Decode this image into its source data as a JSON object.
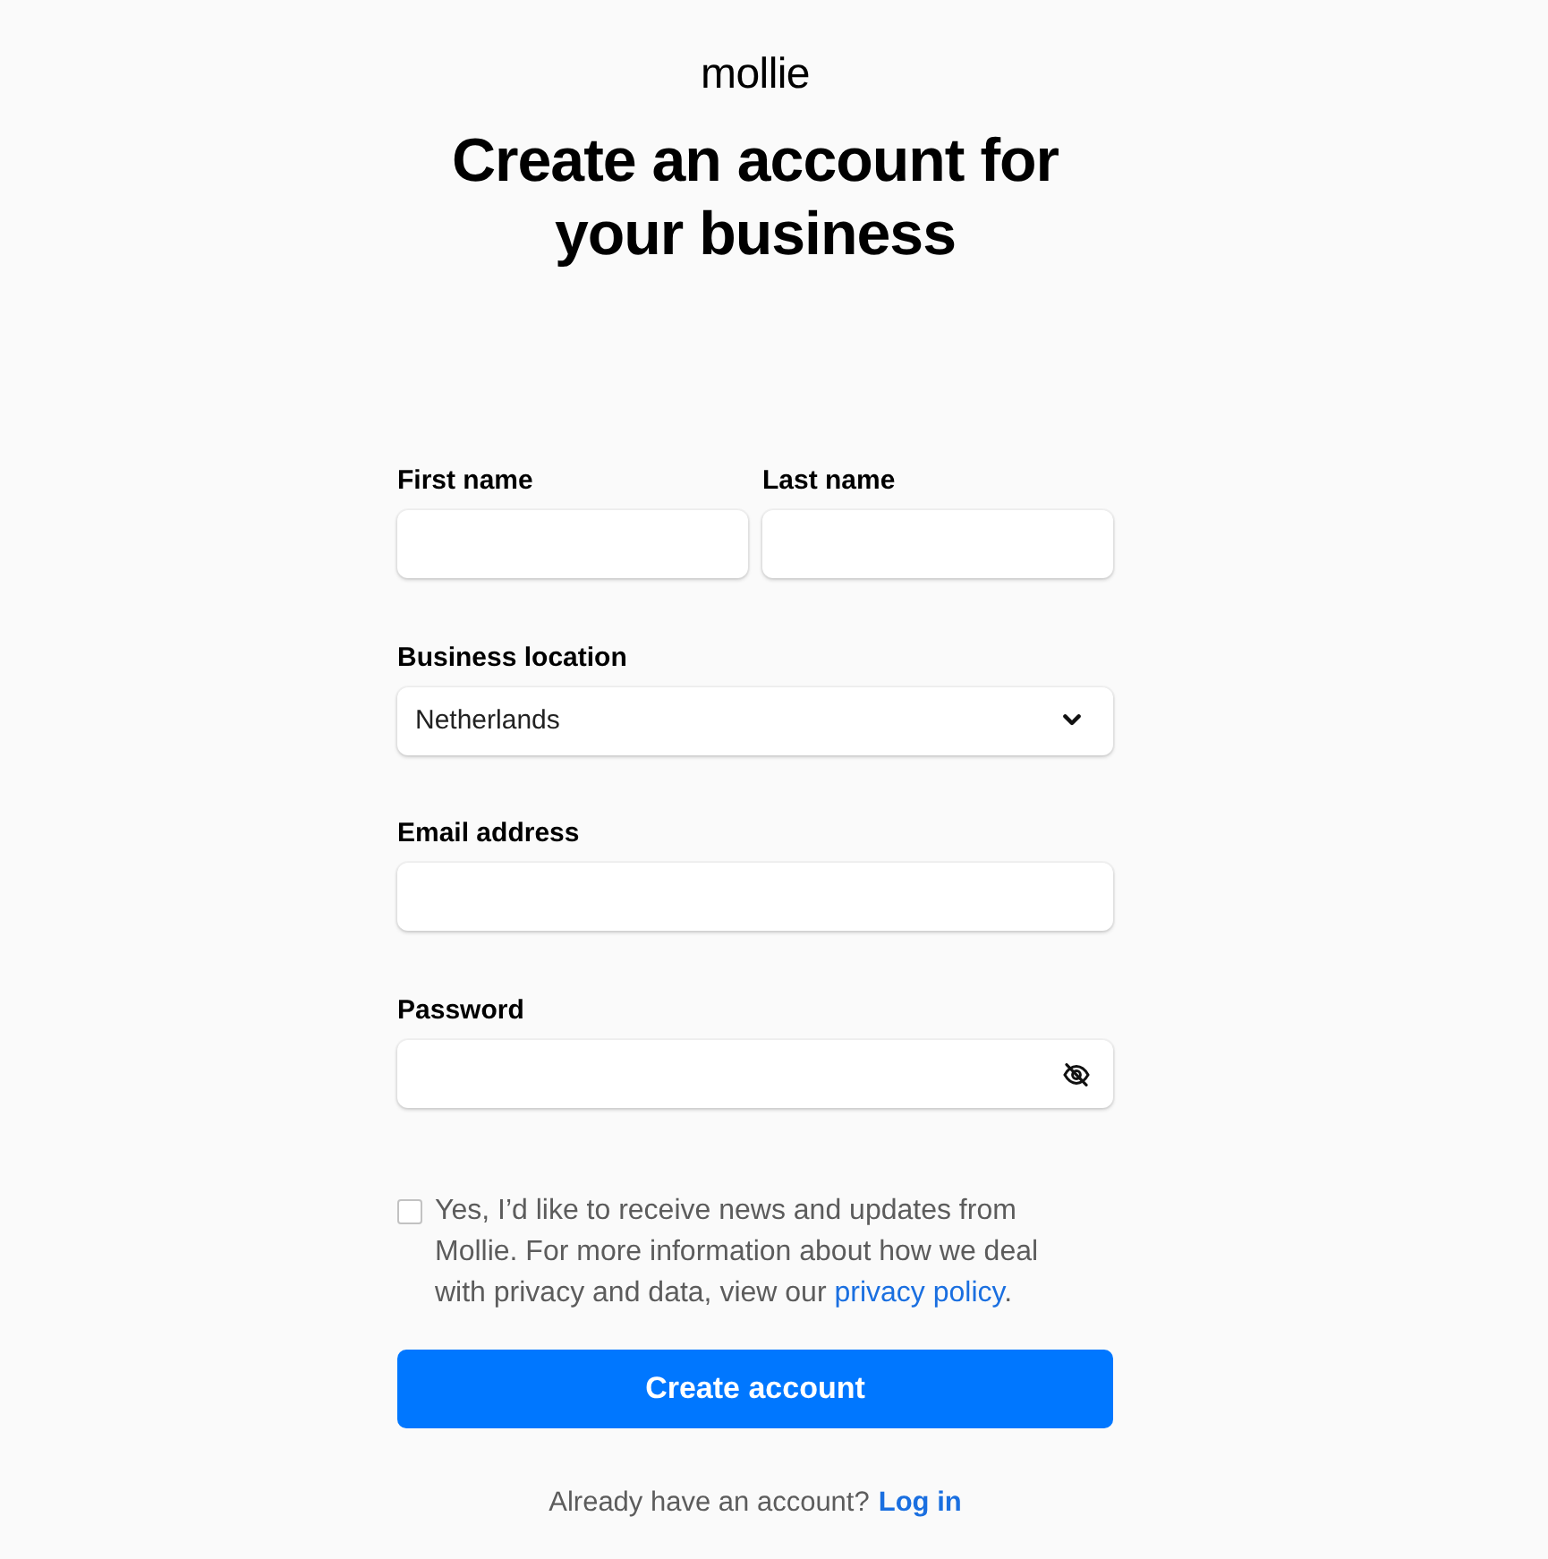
{
  "logo": {
    "text": "mollie"
  },
  "title": "Create an account for your business",
  "form": {
    "rows": [
      {
        "fields": [
          {
            "label": "First name",
            "kind": "text"
          },
          {
            "label": "Last name",
            "kind": "text"
          }
        ]
      },
      {
        "fields": [
          {
            "label": "Business location",
            "kind": "select",
            "value": "Netherlands"
          }
        ]
      },
      {
        "fields": [
          {
            "label": "Email address",
            "kind": "email"
          }
        ]
      },
      {
        "fields": [
          {
            "label": "Password",
            "kind": "password"
          }
        ]
      }
    ]
  },
  "consent": {
    "checked": false,
    "text": "Yes, I’d like to receive news and updates from Mollie. For more information about how we deal with privacy and data, view our",
    "link": "privacy policy",
    "after": "."
  },
  "submit": {
    "label": "Create account"
  },
  "login": {
    "prompt": "Already have an account?",
    "link": "Log in"
  }
}
